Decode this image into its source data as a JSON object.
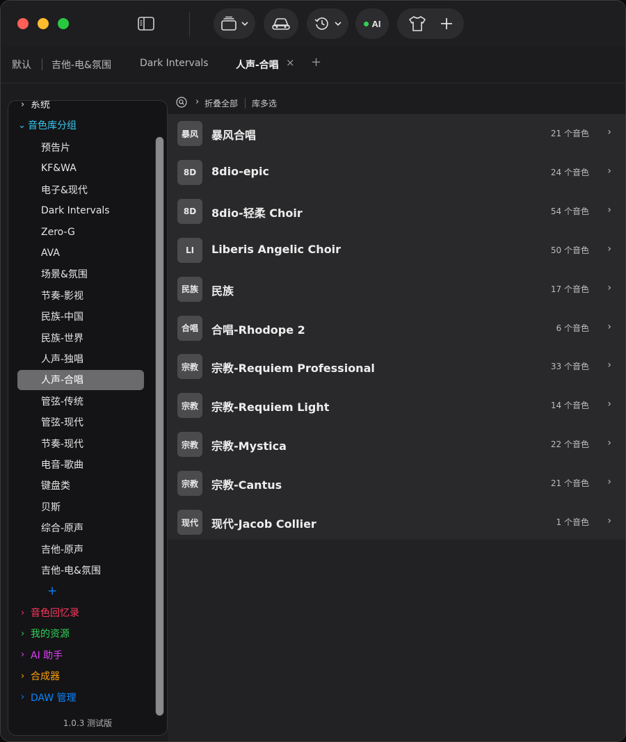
{
  "colors": {
    "accent_cyan": "#35c8f0",
    "accent_pink": "#ff375f",
    "accent_green": "#30d158",
    "accent_magenta": "#e040fb",
    "accent_orange": "#ff9f0a",
    "accent_blue": "#0a84ff"
  },
  "titlebar": {
    "icons": [
      "sidebar-toggle-icon",
      "window-stack-icon",
      "car-icon",
      "history-icon",
      "shirt-icon",
      "plus-icon"
    ],
    "ai_label": "AI"
  },
  "tabs": [
    {
      "label": "默认"
    },
    {
      "label": "吉他-电&氛围"
    },
    {
      "label": "Dark Intervals"
    },
    {
      "label": "人声-合唱",
      "active": true
    }
  ],
  "tab_close": "×",
  "tab_add": "+",
  "sidebar": {
    "sections_top": [
      {
        "label": "系统",
        "expanded": false
      },
      {
        "label": "音色库分组",
        "expanded": true
      }
    ],
    "group_items": [
      "预告片",
      "KF&WA",
      "电子&现代",
      "Dark Intervals",
      "Zero-G",
      "AVA",
      "场景&氛围",
      "节奏-影视",
      "民族-中国",
      "民族-世界",
      "人声-独唱",
      "人声-合唱",
      "管弦-传统",
      "管弦-现代",
      "节奏-现代",
      "电音-歌曲",
      "键盘类",
      "贝斯",
      "综合-原声",
      "吉他-原声",
      "吉他-电&氛围"
    ],
    "selected_item": "人声-合唱",
    "add_label": "+",
    "sections_bottom": [
      {
        "label": "音色回忆录",
        "color": "#ff375f"
      },
      {
        "label": "我的资源",
        "color": "#30d158"
      },
      {
        "label": "AI 助手",
        "color": "#e040fb"
      },
      {
        "label": "合成器",
        "color": "#ff9f0a"
      },
      {
        "label": "DAW 管理",
        "color": "#0a84ff"
      }
    ],
    "version": "1.0.3 测试版"
  },
  "main": {
    "toolbar": {
      "collapse_all": "折叠全部",
      "multi_select": "库多选"
    },
    "libraries": [
      {
        "badge": "暴风",
        "name": "暴风合唱",
        "count": "21 个音色"
      },
      {
        "badge": "8D",
        "name": "8dio-epic",
        "count": "24 个音色"
      },
      {
        "badge": "8D",
        "name": "8dio-轻柔 Choir",
        "count": "54 个音色"
      },
      {
        "badge": "LI",
        "name": "Liberis Angelic Choir",
        "count": "50 个音色"
      },
      {
        "badge": "民族",
        "name": "民族",
        "count": "17 个音色"
      },
      {
        "badge": "合唱",
        "name": "合唱-Rhodope 2",
        "count": "6 个音色"
      },
      {
        "badge": "宗教",
        "name": "宗教-Requiem Professional",
        "count": "33 个音色"
      },
      {
        "badge": "宗教",
        "name": "宗教-Requiem Light",
        "count": "14 个音色"
      },
      {
        "badge": "宗教",
        "name": "宗教-Mystica",
        "count": "22 个音色"
      },
      {
        "badge": "宗教",
        "name": "宗教-Cantus",
        "count": "21 个音色"
      },
      {
        "badge": "现代",
        "name": "现代-Jacob Collier",
        "count": "1 个音色"
      }
    ]
  }
}
